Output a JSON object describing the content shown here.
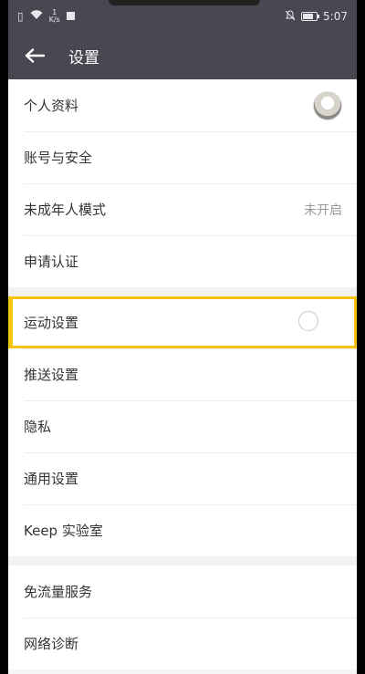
{
  "status_bar": {
    "speed_top": "1",
    "speed_unit": "K/s",
    "time": "5:07"
  },
  "header": {
    "title": "设置"
  },
  "groups": [
    {
      "items": [
        {
          "label": "个人资料",
          "trailing": "avatar"
        },
        {
          "label": "账号与安全"
        },
        {
          "label": "未成年人模式",
          "value": "未开启"
        },
        {
          "label": "申请认证"
        }
      ]
    },
    {
      "items": [
        {
          "label": "运动设置",
          "highlighted": true
        },
        {
          "label": "推送设置"
        },
        {
          "label": "隐私"
        },
        {
          "label": "通用设置"
        },
        {
          "label": "Keep 实验室"
        }
      ]
    },
    {
      "items": [
        {
          "label": "免流量服务"
        },
        {
          "label": "网络诊断"
        }
      ]
    }
  ],
  "colors": {
    "bar_bg": "#4b4752",
    "highlight": "#f4c40f"
  }
}
